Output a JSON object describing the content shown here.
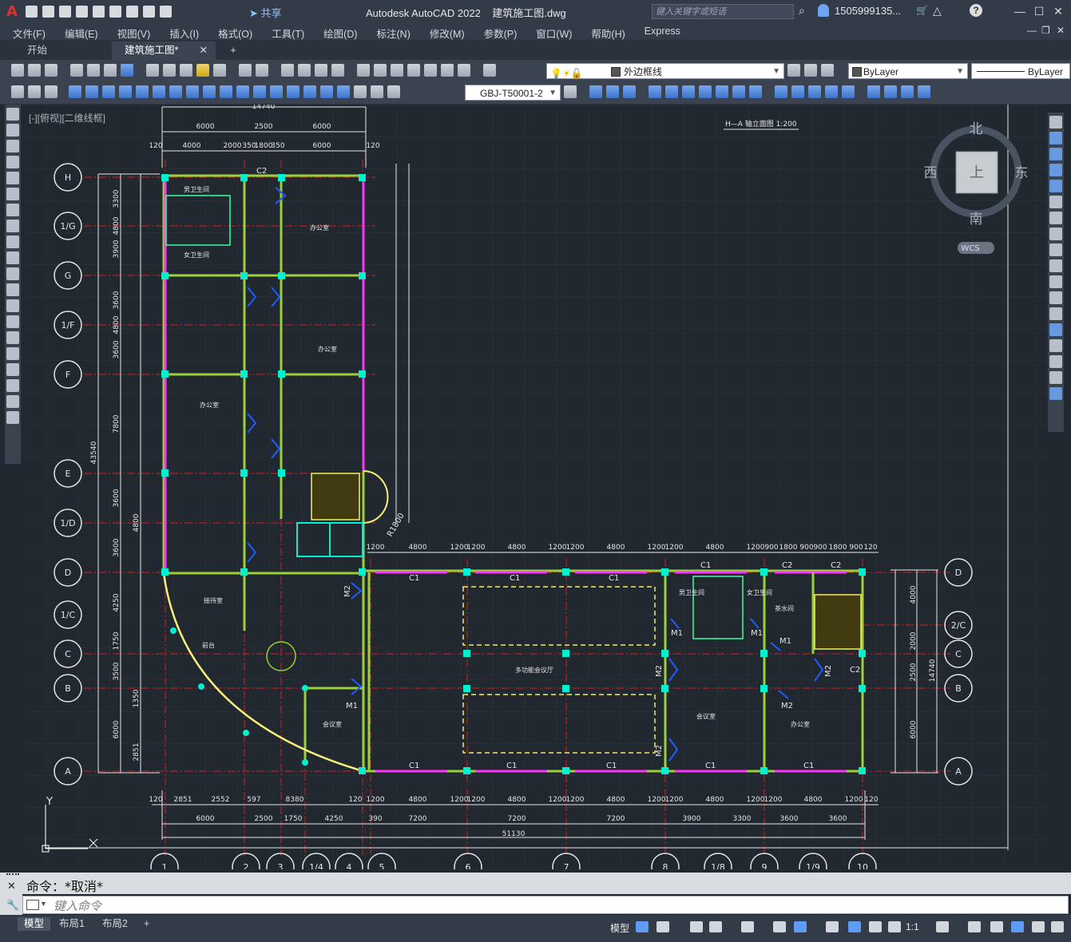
{
  "app": {
    "title": "Autodesk AutoCAD 2022    建筑施工图.dwg",
    "share": "共享",
    "search_placeholder": "键入关键字或短语",
    "user": "1505999135...",
    "logo": "A"
  },
  "menu": [
    "文件(F)",
    "编辑(E)",
    "视图(V)",
    "插入(I)",
    "格式(O)",
    "工具(T)",
    "绘图(D)",
    "标注(N)",
    "修改(M)",
    "参数(P)",
    "窗口(W)",
    "帮助(H)",
    "Express"
  ],
  "tabs": {
    "start": "开始",
    "doc": "建筑施工图*",
    "close": "✕",
    "add": "+"
  },
  "toolbar": {
    "layer_combo": "外边框线",
    "color_combo": "ByLayer",
    "linetype_combo": "ByLayer",
    "dimstyle_combo": "GBJ-T50001-2"
  },
  "view_label": "[-][俯视][二维线框]",
  "viewcube": {
    "north": "北",
    "south": "南",
    "east": "东",
    "west": "西",
    "top": "上",
    "wcs": "WCS"
  },
  "drawing": {
    "title_note": "H—A 轴立面图 1:200",
    "left_axes": [
      "H",
      "1/G",
      "G",
      "1/F",
      "F",
      "E",
      "1/D",
      "D",
      "1/C",
      "C",
      "B",
      "A"
    ],
    "right_axes": [
      "D",
      "2/C",
      "C",
      "B",
      "A"
    ],
    "bottom_axes": [
      "1",
      "2",
      "3",
      "1/4",
      "4",
      "5",
      "6",
      "7",
      "8",
      "1/8",
      "9",
      "1/9",
      "10"
    ],
    "top_dims": [
      "6000",
      "2500",
      "6000"
    ],
    "top_dims2": [
      "120",
      "4000",
      "2000",
      "350",
      "1800",
      "350",
      "6000",
      "120"
    ],
    "top_total": "14740",
    "left_total": "43540",
    "left_dims": [
      "3300",
      "4800",
      "3900",
      "3600",
      "4800",
      "3600",
      "7800",
      "3600",
      "4800",
      "3600",
      "4250",
      "1750",
      "3500",
      "1350",
      "6000",
      "2851"
    ],
    "right_dims": [
      "4000",
      "2000",
      "2500",
      "6000"
    ],
    "right_total": "14740",
    "mid_dims": [
      "1200",
      "4800",
      "1200",
      "1200",
      "4800",
      "1200",
      "1200",
      "4800",
      "1200",
      "1200",
      "4800",
      "1200",
      "900",
      "1800",
      "900",
      "900",
      "1800",
      "900",
      "120"
    ],
    "bottom_dims1": [
      "120",
      "2851",
      "2552",
      "597",
      "8380",
      "120",
      "1200",
      "4800",
      "1200",
      "1200",
      "4800",
      "1200",
      "1200",
      "4800",
      "1200",
      "1200",
      "4800",
      "1200",
      "1200",
      "4800",
      "1200",
      "120"
    ],
    "bottom_dims2": [
      "6000",
      "2500",
      "1750",
      "4250",
      "390",
      "7200",
      "7200",
      "7200",
      "3900",
      "3300",
      "3600",
      "3600"
    ],
    "bottom_total": "51130",
    "rooms": [
      "男卫生间",
      "女卫生间",
      "办公室",
      "办公室",
      "办公室",
      "接待室",
      "多功能会议厅",
      "男卫生间",
      "女卫生间",
      "会议室",
      "会议室",
      "办公室",
      "前台",
      "茶水间"
    ],
    "labels": [
      "C1",
      "C2",
      "M1",
      "M2",
      "R1800"
    ]
  },
  "command": {
    "history": "命令：*取消*",
    "placeholder": "键入命令"
  },
  "status": {
    "layouts": [
      "模型",
      "布局1",
      "布局2"
    ],
    "add": "+",
    "model": "模型",
    "scale": "1:1"
  }
}
